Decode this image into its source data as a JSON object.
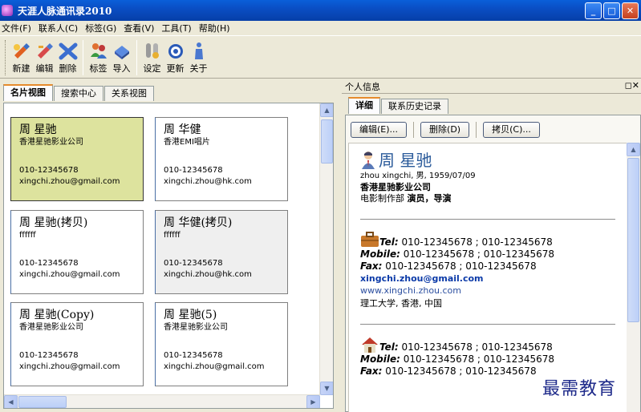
{
  "window": {
    "title": "天涯人脉通讯录2010",
    "min": "_",
    "max": "□",
    "close": "✕"
  },
  "menu": [
    "文件(F)",
    "联系人(C)",
    "标签(G)",
    "查看(V)",
    "工具(T)",
    "帮助(H)"
  ],
  "toolbar": {
    "new": "新建",
    "edit": "编辑",
    "delete": "删除",
    "tag": "标签",
    "import": "导入",
    "settings": "设定",
    "update": "更新",
    "about": "关于"
  },
  "left_tabs": [
    "名片视图",
    "搜索中心",
    "关系视图"
  ],
  "cards": [
    {
      "name": "周 星驰",
      "company": "香港星驰影业公司",
      "phone": "010-12345678",
      "email": "xingchi.zhou@gmail.com"
    },
    {
      "name": "周 华健",
      "company": "香港EMI唱片",
      "phone": "010-12345678",
      "email": "xingchi.zhou@hk.com"
    },
    {
      "name": "周 星驰(拷贝)",
      "company": "ffffff",
      "phone": "010-12345678",
      "email": "xingchi.zhou@gmail.com"
    },
    {
      "name": "周 华健(拷贝)",
      "company": "ffffff",
      "phone": "010-12345678",
      "email": "xingchi.zhou@hk.com"
    },
    {
      "name": "周 星驰(Copy)",
      "company": "香港星驰影业公司",
      "phone": "010-12345678",
      "email": "xingchi.zhou@gmail.com"
    },
    {
      "name": "周 星驰(5)",
      "company": "香港星驰影业公司",
      "phone": "010-12345678",
      "email": "xingchi.zhou@gmail.com"
    }
  ],
  "right_panel": {
    "header": "个人信息",
    "header_ctrl": "◻✕",
    "tabs": [
      "详细",
      "联系历史记录"
    ],
    "buttons": {
      "edit": "编辑(E)...",
      "delete": "删除(D)",
      "copy": "拷贝(C)..."
    },
    "person": {
      "name": "周 星驰",
      "info": "zhou xingchi, 男, 1959/07/09",
      "company": "香港星驰影业公司",
      "dept": "电影制作部",
      "title": "演员，导演"
    },
    "work": {
      "tel_label": "Tel:",
      "tel": " 010-12345678 ; 010-12345678",
      "mobile_label": "Mobile:",
      "mobile": " 010-12345678 ; 010-12345678",
      "fax_label": "Fax:",
      "fax": " 010-12345678 ; 010-12345678",
      "email": "xingchi.zhou@gmail.com",
      "web": "www.xingchi.zhou.com",
      "address": "理工大学, 香港, 中国"
    },
    "home": {
      "tel_label": "Tel:",
      "tel": " 010-12345678 ; 010-12345678",
      "mobile_label": "Mobile:",
      "mobile": " 010-12345678 ; 010-12345678",
      "fax_label": "Fax:",
      "fax": " 010-12345678 ; 010-12345678"
    }
  },
  "watermark": "最需教育",
  "colors": {
    "title_bar": "#0a4ec4",
    "selected_card": "#dde39e",
    "link": "#0b3aa8"
  }
}
